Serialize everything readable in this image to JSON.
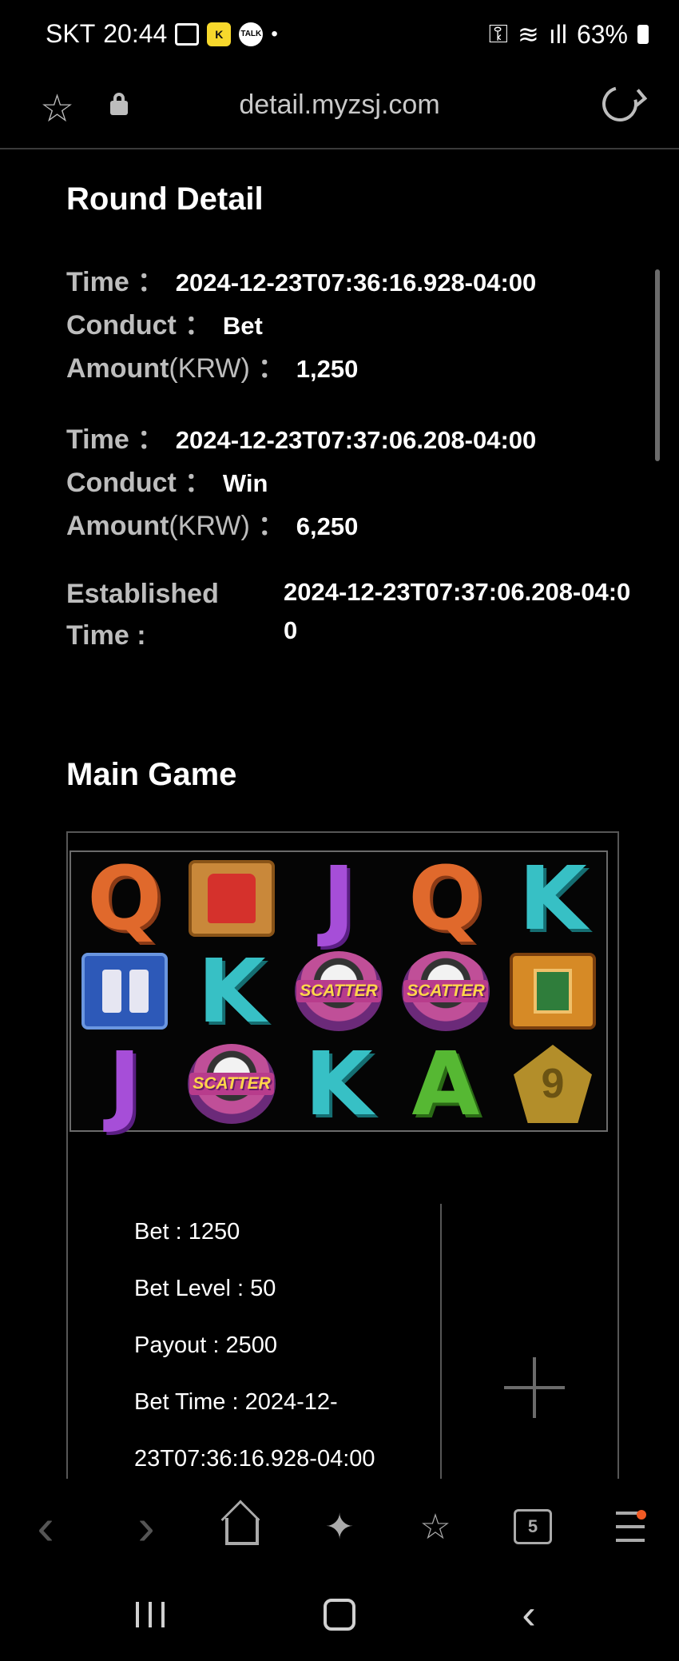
{
  "status_bar": {
    "carrier": "SKT",
    "time": "20:44",
    "kakao_badge": "K",
    "talk_badge": "TALK",
    "notification_dot": "•",
    "battery_percent": "63%",
    "key_glyph": "⚿",
    "wifi_glyph": "≋",
    "signal_glyph": "ıll"
  },
  "url_bar": {
    "star_glyph": "☆",
    "url": "detail.myzsj.com"
  },
  "round_detail": {
    "title": "Round Detail",
    "records": [
      {
        "time_label": "Time",
        "time_value": "2024-12-23T07:36:16.928-04:00",
        "conduct_label": "Conduct",
        "conduct_value": "Bet",
        "amount_label": "Amount",
        "amount_unit": "(KRW)",
        "amount_value": "1,250"
      },
      {
        "time_label": "Time",
        "time_value": "2024-12-23T07:37:06.208-04:00",
        "conduct_label": "Conduct",
        "conduct_value": "Win",
        "amount_label": "Amount",
        "amount_unit": "(KRW)",
        "amount_value": "6,250"
      }
    ],
    "separator": "：",
    "established_label": "Established Time :",
    "established_value": "2024-12-23T07:37:06.208-04:00"
  },
  "main_game": {
    "title": "Main Game",
    "reels": [
      [
        "Q",
        "jersey",
        "J",
        "Q",
        "K"
      ],
      [
        "drinks",
        "K",
        "scatter",
        "scatter",
        "board"
      ],
      [
        "J",
        "scatter",
        "K",
        "A",
        "nine"
      ]
    ],
    "scatter_text": "SCATTER",
    "nine_text": "9",
    "info": {
      "bet": "Bet : 1250",
      "bet_level": "Bet Level : 50",
      "payout": "Payout : 2500",
      "bet_time_line1": "Bet Time : 2024-12-",
      "bet_time_line2": "23T07:36:16.928-04:00"
    }
  },
  "toolbar": {
    "back_glyph": "‹",
    "forward_glyph": "›",
    "ai_glyph": "✦",
    "bookmarks_glyph": "☆",
    "tabs_count": "5"
  },
  "nav": {
    "back_glyph": "‹"
  }
}
